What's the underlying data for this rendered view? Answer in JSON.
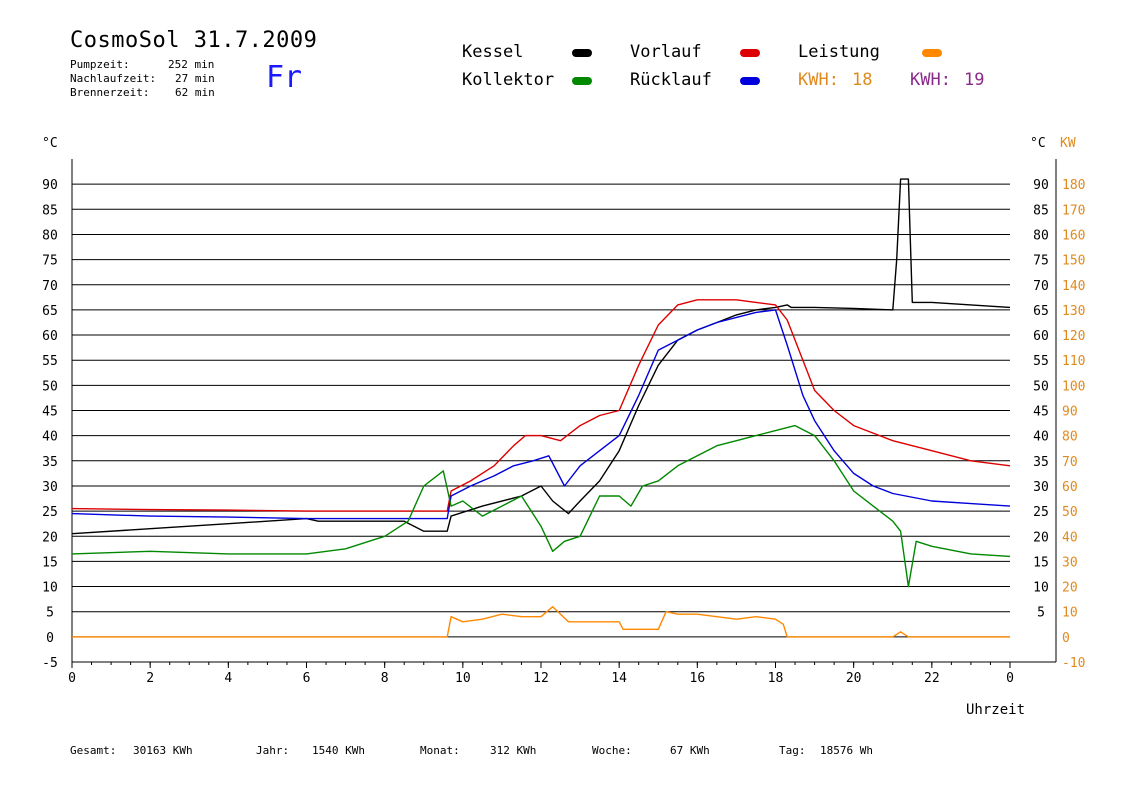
{
  "header": {
    "title": "CosmoSol 31.7.2009",
    "day": "Fr",
    "stats": [
      {
        "label": "Pumpzeit:",
        "value": "252 min"
      },
      {
        "label": "Nachlaufzeit:",
        "value": "27 min"
      },
      {
        "label": "Brennerzeit:",
        "value": "62 min"
      }
    ]
  },
  "legend": {
    "items": [
      {
        "name": "Kessel",
        "color": "#000000"
      },
      {
        "name": "Vorlauf",
        "color": "#dd0000"
      },
      {
        "name": "Leistung",
        "color": "#ff8800"
      },
      {
        "name": "Kollektor",
        "color": "#008800"
      },
      {
        "name": "Rücklauf",
        "color": "#0000dd"
      }
    ],
    "kwh": [
      {
        "label": "KWH:",
        "value": "18",
        "color": "#e08a1e"
      },
      {
        "label": "KWH:",
        "value": "19",
        "color": "#8a2a8a"
      }
    ]
  },
  "footer": {
    "items": [
      {
        "label": "Gesamt:",
        "value": "30163 KWh"
      },
      {
        "label": "Jahr:",
        "value": "1540 KWh"
      },
      {
        "label": "Monat:",
        "value": "312 KWh"
      },
      {
        "label": "Woche:",
        "value": "67 KWh"
      },
      {
        "label": "Tag:",
        "value": "18576 Wh"
      }
    ]
  },
  "chart_data": {
    "type": "line",
    "title": "CosmoSol 31.7.2009",
    "xlabel": "Uhrzeit",
    "ylabel_left": "°C",
    "ylabel_right": "KW",
    "xlim": [
      0,
      24
    ],
    "ylim_left": [
      -5,
      95
    ],
    "ylim_right": [
      -10,
      190
    ],
    "x_ticks": [
      "0",
      "2",
      "4",
      "6",
      "8",
      "10",
      "12",
      "14",
      "16",
      "18",
      "20",
      "22",
      "0"
    ],
    "y_ticks_left": [
      "-5",
      "0",
      "5",
      "10",
      "15",
      "20",
      "25",
      "30",
      "35",
      "40",
      "45",
      "50",
      "55",
      "60",
      "65",
      "70",
      "75",
      "80",
      "85",
      "90"
    ],
    "y_ticks_right_c": [
      "5",
      "10",
      "15",
      "20",
      "25",
      "30",
      "35",
      "40",
      "45",
      "50",
      "55",
      "60",
      "65",
      "70",
      "75",
      "80",
      "85",
      "90"
    ],
    "y_ticks_right_kw": [
      "-10",
      "0",
      "10",
      "20",
      "30",
      "40",
      "50",
      "60",
      "70",
      "80",
      "90",
      "100",
      "110",
      "120",
      "130",
      "140",
      "150",
      "160",
      "170",
      "180"
    ],
    "unit_c": "°C",
    "unit_kw": "KW",
    "grid": true,
    "legend_position": "top",
    "series": [
      {
        "name": "Kessel",
        "color": "#000000",
        "x": [
          0,
          2,
          4,
          6,
          6.3,
          8.5,
          9.0,
          9.6,
          9.7,
          10.5,
          11.5,
          12.0,
          12.3,
          12.7,
          13.0,
          13.5,
          14.0,
          14.5,
          15.0,
          15.5,
          16.0,
          16.5,
          17.0,
          17.5,
          18.0,
          18.3,
          18.4,
          19.0,
          20.0,
          21.0,
          21.1,
          21.2,
          21.4,
          21.5,
          22.0,
          23.0,
          24.0
        ],
        "y": [
          20.5,
          21.5,
          22.5,
          23.5,
          23.0,
          23.0,
          21.0,
          21.0,
          24.0,
          26.0,
          28.0,
          30.0,
          27.0,
          24.5,
          27.0,
          31.0,
          37.0,
          46.0,
          54.0,
          59.0,
          61.0,
          62.5,
          64.0,
          65.0,
          65.5,
          66.0,
          65.5,
          65.5,
          65.3,
          65.0,
          75.0,
          91.0,
          91.0,
          66.5,
          66.5,
          66.0,
          65.5
        ]
      },
      {
        "name": "Vorlauf",
        "color": "#dd0000",
        "x": [
          0,
          2,
          4,
          6,
          8,
          9.6,
          9.7,
          10.2,
          10.8,
          11.3,
          11.6,
          12.0,
          12.5,
          13.0,
          13.5,
          14.0,
          14.5,
          15.0,
          15.5,
          16.0,
          16.5,
          17.0,
          17.5,
          18.0,
          18.3,
          18.7,
          19.0,
          19.5,
          20.0,
          21.0,
          22.0,
          23.0,
          24.0
        ],
        "y": [
          25.5,
          25.3,
          25.2,
          25.0,
          25.0,
          25.0,
          29.0,
          31.0,
          34.0,
          38.0,
          40.0,
          40.0,
          39.0,
          42.0,
          44.0,
          45.0,
          54.0,
          62.0,
          66.0,
          67.0,
          67.0,
          67.0,
          66.5,
          66.0,
          63.0,
          55.0,
          49.0,
          45.0,
          42.0,
          39.0,
          37.0,
          35.0,
          34.0
        ]
      },
      {
        "name": "Rücklauf",
        "color": "#0000dd",
        "x": [
          0,
          2,
          4,
          6,
          8,
          9.6,
          9.7,
          10.2,
          10.8,
          11.3,
          11.8,
          12.2,
          12.6,
          13.0,
          13.5,
          14.0,
          14.5,
          15.0,
          15.5,
          16.0,
          16.5,
          17.0,
          17.5,
          18.0,
          18.3,
          18.7,
          19.0,
          19.5,
          20.0,
          20.5,
          21.0,
          22.0,
          23.0,
          24.0
        ],
        "y": [
          24.5,
          24.0,
          23.8,
          23.5,
          23.5,
          23.5,
          28.0,
          30.0,
          32.0,
          34.0,
          35.0,
          36.0,
          30.0,
          34.0,
          37.0,
          40.0,
          48.0,
          57.0,
          59.0,
          61.0,
          62.5,
          63.5,
          64.5,
          65.0,
          58.0,
          48.0,
          43.0,
          37.0,
          32.5,
          30.0,
          28.5,
          27.0,
          26.5,
          26.0
        ]
      },
      {
        "name": "Kollektor",
        "color": "#008800",
        "x": [
          0,
          2,
          4,
          6,
          7,
          8,
          8.6,
          9.0,
          9.5,
          9.7,
          10.0,
          10.5,
          11.0,
          11.5,
          12.0,
          12.3,
          12.6,
          13.0,
          13.5,
          14.0,
          14.3,
          14.6,
          15.0,
          15.5,
          16.0,
          16.5,
          17.0,
          17.5,
          18.0,
          18.5,
          19.0,
          19.5,
          20.0,
          20.5,
          21.0,
          21.2,
          21.4,
          21.6,
          22.0,
          23.0,
          24.0
        ],
        "y": [
          16.5,
          17.0,
          16.5,
          16.5,
          17.5,
          20.0,
          23.0,
          30.0,
          33.0,
          26.0,
          27.0,
          24.0,
          26.0,
          28.0,
          22.0,
          17.0,
          19.0,
          20.0,
          28.0,
          28.0,
          26.0,
          30.0,
          31.0,
          34.0,
          36.0,
          38.0,
          39.0,
          40.0,
          41.0,
          42.0,
          40.0,
          35.0,
          29.0,
          26.0,
          23.0,
          21.0,
          10.0,
          19.0,
          18.0,
          16.5,
          16.0
        ]
      },
      {
        "name": "Leistung",
        "color": "#ff8800",
        "axis": "right",
        "x": [
          0,
          9.6,
          9.7,
          10.0,
          10.5,
          11.0,
          11.5,
          12.0,
          12.3,
          12.7,
          13.0,
          13.5,
          14.0,
          14.1,
          15.0,
          15.2,
          15.5,
          16.0,
          16.5,
          17.0,
          17.5,
          18.0,
          18.2,
          18.3,
          21.0,
          21.2,
          21.4,
          21.5,
          24.0
        ],
        "y": [
          0,
          0,
          8,
          6,
          7,
          9,
          8,
          8,
          12,
          6,
          6,
          6,
          6,
          3,
          3,
          10,
          9,
          9,
          8,
          7,
          8,
          7,
          5,
          0,
          0,
          2,
          0,
          0,
          0
        ]
      }
    ]
  }
}
